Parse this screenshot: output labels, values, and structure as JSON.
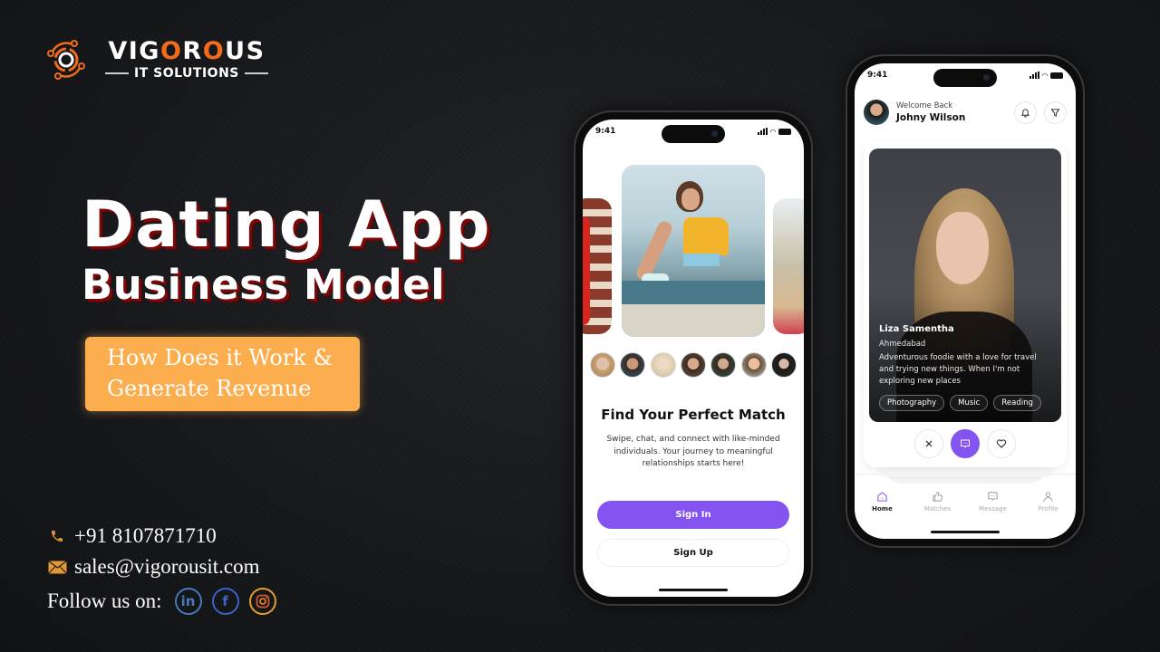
{
  "brand": {
    "name_parts": [
      "VIG",
      "O",
      "R",
      "O",
      "US"
    ],
    "tagline": "IT SOLUTIONS",
    "accent": "#f26b1d"
  },
  "headline": {
    "line1": "Dating App",
    "line2": "Business Model",
    "subtitle_line1": "How Does it Work &",
    "subtitle_line2": "Generate Revenue",
    "subtitle_bg": "#fcae4f",
    "shadow_color": "#7a0a0a"
  },
  "contact": {
    "phone": "+91 8107871710",
    "email": "sales@vigorousit.com",
    "follow_label": "Follow us on:",
    "socials": [
      {
        "name": "linkedin",
        "icon": "in"
      },
      {
        "name": "facebook",
        "icon": "f"
      },
      {
        "name": "instagram",
        "icon": "camera"
      }
    ]
  },
  "phone1": {
    "time": "9:41",
    "title": "Find Your Perfect Match",
    "description": "Swipe, chat, and connect with like-minded individuals. Your journey to meaningful relationships starts here!",
    "sign_in": "Sign In",
    "sign_up": "Sign Up",
    "avatar_count": 7,
    "accent": "#8453f0"
  },
  "phone2": {
    "time": "9:41",
    "welcome": "Welcome Back",
    "user_name": "Johny Wilson",
    "profile": {
      "name": "Liza Samentha",
      "city": "Ahmedabad",
      "bio": "Adventurous foodie with a love for travel and trying new things. When I'm not exploring new places",
      "interests": [
        "Photography",
        "Music",
        "Reading"
      ]
    },
    "tabs": [
      {
        "label": "Home",
        "active": true
      },
      {
        "label": "Matches",
        "active": false
      },
      {
        "label": "Message",
        "active": false
      },
      {
        "label": "Profile",
        "active": false
      }
    ]
  }
}
